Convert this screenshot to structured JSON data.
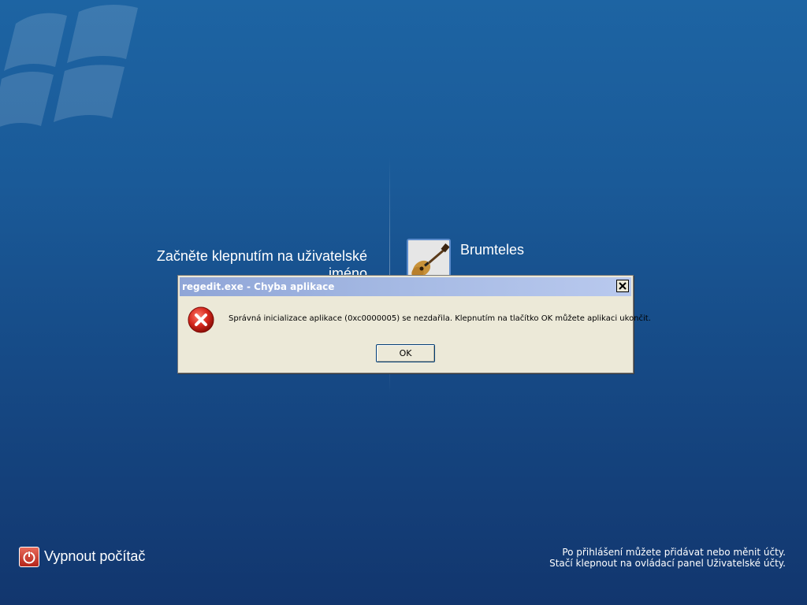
{
  "login": {
    "prompt": "Začněte klepnutím na uživatelské jméno",
    "users": [
      {
        "name": "Brumteles",
        "avatar_icon": "guitar-icon"
      }
    ]
  },
  "dialog": {
    "title": "regedit.exe - Chyba aplikace",
    "message": "Správná inicializace aplikace (0xc0000005) se nezdařila. Klepnutím na tlačítko OK můžete aplikaci ukončit.",
    "ok_label": "OK",
    "icon": "error-icon"
  },
  "footer": {
    "power_label": "Vypnout počítač",
    "info_line1": "Po přihlášení můžete přidávat nebo měnit účty.",
    "info_line2": "Stačí klepnout na ovládací panel Uživatelské účty."
  },
  "colors": {
    "background": "#1a5a98",
    "dialog_bg": "#ece9d8",
    "title_bar": "#a6bae4",
    "error_red": "#d4261c"
  }
}
